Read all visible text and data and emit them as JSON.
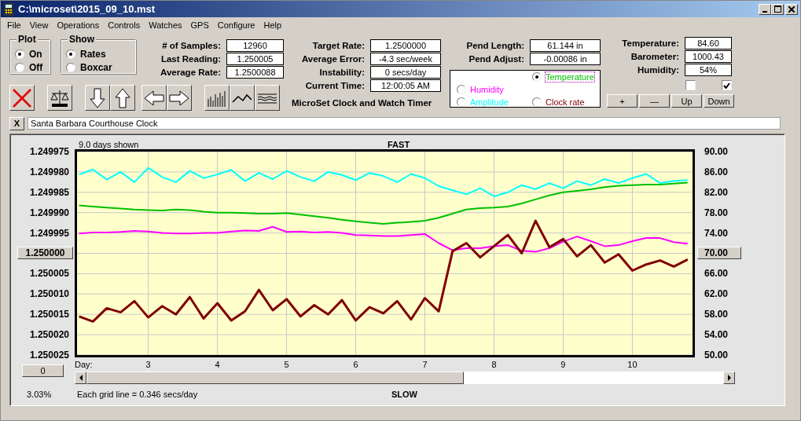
{
  "window": {
    "title": "C:\\microset\\2015_09_10.mst"
  },
  "menu": [
    "File",
    "View",
    "Operations",
    "Controls",
    "Watches",
    "GPS",
    "Configure",
    "Help"
  ],
  "plot_group": {
    "title": "Plot",
    "options": [
      {
        "label": "On",
        "selected": true
      },
      {
        "label": "Off",
        "selected": false
      }
    ]
  },
  "show_group": {
    "title": "Show",
    "options": [
      {
        "label": "Rates",
        "selected": true
      },
      {
        "label": "Boxcar",
        "selected": false
      }
    ]
  },
  "readings_1": [
    {
      "label": "# of Samples:",
      "value": "12960"
    },
    {
      "label": "Last Reading:",
      "value": "1.250005"
    },
    {
      "label": "Average Rate:",
      "value": "1.2500088"
    }
  ],
  "readings_2": [
    {
      "label": "Target Rate:",
      "value": "1.2500000"
    },
    {
      "label": "Average Error:",
      "value": "-4.3 sec/week"
    },
    {
      "label": "Instability:",
      "value": "0 secs/day"
    },
    {
      "label": "Current Time:",
      "value": "12:00:05 AM"
    }
  ],
  "caption": "MicroSet Clock and Watch Timer",
  "readings_3": [
    {
      "label": "Pend Length:",
      "value": "61.144 in"
    },
    {
      "label": "Pend Adjust:",
      "value": "-0.00086 in"
    }
  ],
  "legend": [
    {
      "selected": true
    },
    {
      "selected": false
    },
    {
      "selected": false
    },
    {
      "selected": false
    }
  ],
  "readings_4": [
    {
      "label": "Temperature:",
      "value": "84.60"
    },
    {
      "label": "Barometer:",
      "value": "1000.43"
    },
    {
      "label": "Humidity:",
      "value": "54%"
    }
  ],
  "checkboxes": [
    {
      "checked": false
    },
    {
      "checked": true
    }
  ],
  "adjust_buttons": [
    "+",
    "—",
    "Up",
    "Down"
  ],
  "note": {
    "close": "X",
    "value": "Santa Barbara Courthouse Clock"
  },
  "chart": {
    "span_label": "9.0 days shown",
    "top_label": "FAST",
    "bottom_label": "SLOW",
    "left_axis": [
      {
        "text": "1.249975",
        "kind": "label"
      },
      {
        "text": "1.249980",
        "kind": "label"
      },
      {
        "text": "1.249985",
        "kind": "label"
      },
      {
        "text": "1.249990",
        "kind": "label"
      },
      {
        "text": "1.249995",
        "kind": "label"
      },
      {
        "text": "1.250000",
        "kind": "button"
      },
      {
        "text": "1.250005",
        "kind": "label"
      },
      {
        "text": "1.250010",
        "kind": "label"
      },
      {
        "text": "1.250015",
        "kind": "label"
      },
      {
        "text": "1.250020",
        "kind": "label"
      },
      {
        "text": "1.250025",
        "kind": "label"
      }
    ],
    "zero_button": "0",
    "day_label": "Day:",
    "grid_note": "Each grid line = 0.346 secs/day",
    "percent": "3.03%",
    "chart_data": {
      "type": "line",
      "xlim": [
        1.97,
        10.87
      ],
      "ylim": [
        50,
        90
      ],
      "grid": true,
      "yticks": [
        {
          "value": 90,
          "label": "90.00"
        },
        {
          "value": 86,
          "label": "86.00"
        },
        {
          "value": 82,
          "label": "82.00"
        },
        {
          "value": 78,
          "label": "78.00"
        },
        {
          "value": 74,
          "label": "74.00"
        },
        {
          "value": 70,
          "label": "70.00"
        },
        {
          "value": 66,
          "label": "66.00"
        },
        {
          "value": 62,
          "label": "62.00"
        },
        {
          "value": 58,
          "label": "58.00"
        },
        {
          "value": 54,
          "label": "54.00"
        },
        {
          "value": 50,
          "label": "50.00"
        }
      ],
      "xticks": [
        {
          "value": 3,
          "label": "3"
        },
        {
          "value": 4,
          "label": "4"
        },
        {
          "value": 5,
          "label": "5"
        },
        {
          "value": 6,
          "label": "6"
        },
        {
          "value": 7,
          "label": "7"
        },
        {
          "value": 8,
          "label": "8"
        },
        {
          "value": 9,
          "label": "9"
        },
        {
          "value": 10,
          "label": "10"
        }
      ],
      "x": [
        2,
        2.2,
        2.4,
        2.6,
        2.8,
        3,
        3.2,
        3.4,
        3.6,
        3.8,
        4,
        4.2,
        4.4,
        4.6,
        4.8,
        5,
        5.2,
        5.4,
        5.6,
        5.8,
        6,
        6.2,
        6.4,
        6.6,
        6.8,
        7,
        7.2,
        7.4,
        7.6,
        7.8,
        8,
        8.2,
        8.4,
        8.6,
        8.8,
        9,
        9.2,
        9.4,
        9.6,
        9.8,
        10,
        10.2,
        10.4,
        10.6,
        10.8
      ],
      "series": [
        {
          "name": "Temperature",
          "color": "#00c000",
          "values": [
            79.4,
            79.2,
            79,
            78.8,
            78.6,
            78.5,
            78.4,
            78.6,
            78.5,
            78.2,
            78,
            78,
            77.9,
            77.8,
            77.8,
            77.9,
            77.6,
            77.3,
            77,
            76.6,
            76.3,
            76,
            75.8,
            76,
            76.2,
            76.4,
            77,
            77.8,
            78.6,
            78.9,
            79,
            79.2,
            79.8,
            80.6,
            81.4,
            82,
            82.3,
            82.6,
            83,
            83.3,
            83.4,
            83.5,
            83.5,
            83.7,
            83.9
          ]
        },
        {
          "name": "Humidity",
          "color": "#ff00ff",
          "values": [
            73.9,
            74.1,
            74.1,
            74.2,
            74.4,
            74.3,
            74,
            73.9,
            73.9,
            74,
            74,
            74.3,
            74.5,
            74.4,
            75.2,
            74.2,
            74.3,
            74.1,
            74.2,
            74,
            73.6,
            73.5,
            73.4,
            73.4,
            73.6,
            73.8,
            72,
            70.6,
            71,
            71,
            71.4,
            71.6,
            70.5,
            70.3,
            71,
            72.3,
            73.3,
            72.4,
            71.4,
            71.6,
            72.4,
            73,
            73,
            72.2,
            71.9
          ]
        },
        {
          "name": "Amplitude",
          "color": "#00ffff",
          "values": [
            85.5,
            86.5,
            84.5,
            86,
            84,
            86.8,
            85,
            84,
            86.2,
            84.8,
            85.5,
            86.4,
            84.2,
            85.8,
            84.6,
            86.2,
            85,
            84.2,
            86,
            85.4,
            84.4,
            85.8,
            85.2,
            84,
            85.6,
            84.8,
            83.2,
            82.4,
            81.6,
            82.8,
            81.2,
            82,
            83.4,
            82.6,
            83.8,
            82.8,
            84.2,
            83.4,
            84.6,
            83.8,
            84.8,
            85.6,
            83.8,
            84.2,
            84.4
          ]
        },
        {
          "name": "Clock rate",
          "color": "#800000",
          "values": [
            57.6,
            56.6,
            59.2,
            58.4,
            60.6,
            57.4,
            59.6,
            58,
            61.4,
            57.2,
            60.2,
            56.8,
            58.6,
            62.8,
            58.8,
            61,
            57.6,
            59.8,
            58,
            60.8,
            56.8,
            59.4,
            58.2,
            60.6,
            57,
            61.2,
            58.6,
            70.4,
            72,
            69.2,
            71.4,
            73.6,
            70,
            76.4,
            71.2,
            72.8,
            69.4,
            71.6,
            68.2,
            69.8,
            66.6,
            67.8,
            68.6,
            67.4,
            68.8
          ]
        }
      ]
    }
  }
}
